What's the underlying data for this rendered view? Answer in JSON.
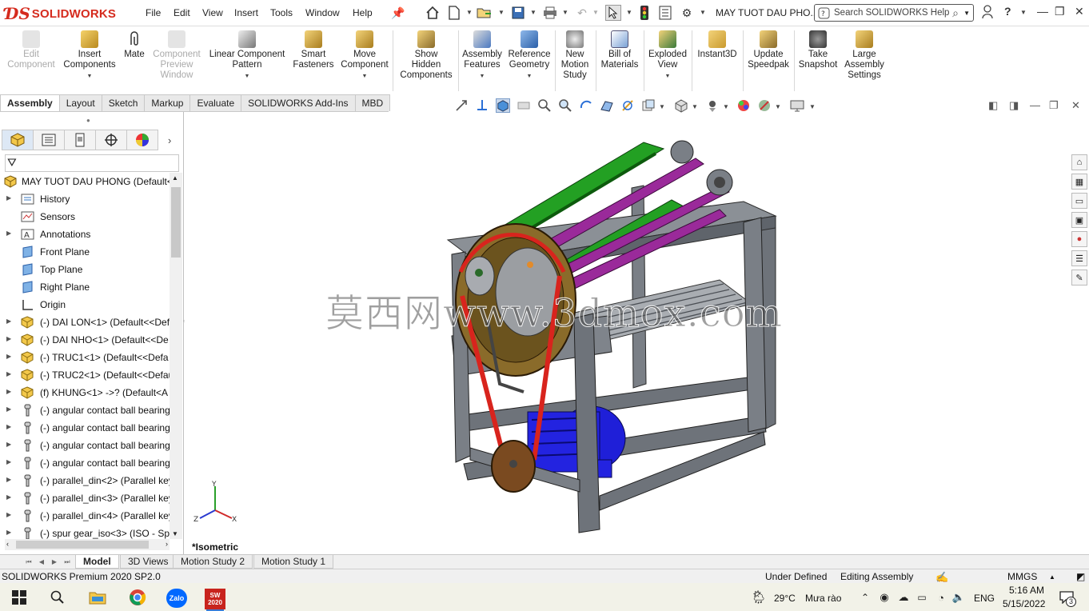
{
  "app": {
    "brand": "SOLIDWORKS",
    "menus": [
      "File",
      "Edit",
      "View",
      "Insert",
      "Tools",
      "Window",
      "Help"
    ],
    "document_title": "MAY TUOT DAU PHO...",
    "search_placeholder": "Search SOLIDWORKS Help"
  },
  "command_manager": {
    "edit_component": "Edit\nComponent",
    "insert_components": "Insert\nComponents",
    "mate": "Mate",
    "component_preview": "Component\nPreview\nWindow",
    "linear_pattern": "Linear Component\nPattern",
    "smart_fasteners": "Smart\nFasteners",
    "move_component": "Move\nComponent",
    "show_hidden": "Show\nHidden\nComponents",
    "assembly_features": "Assembly\nFeatures",
    "reference_geometry": "Reference\nGeometry",
    "new_motion_study": "New\nMotion\nStudy",
    "bill_of_materials": "Bill of\nMaterials",
    "exploded_view": "Exploded\nView",
    "instant3d": "Instant3D",
    "update_speedpak": "Update\nSpeedpak",
    "take_snapshot": "Take\nSnapshot",
    "large_assembly": "Large\nAssembly\nSettings"
  },
  "command_tabs": [
    "Assembly",
    "Layout",
    "Sketch",
    "Markup",
    "Evaluate",
    "SOLIDWORKS Add-Ins",
    "MBD"
  ],
  "tree": {
    "root": "MAY TUOT DAU PHONG  (Default<",
    "items": [
      {
        "label": "History",
        "icon": "history-icon"
      },
      {
        "label": "Sensors",
        "icon": "sensors-icon"
      },
      {
        "label": "Annotations",
        "icon": "annotations-icon"
      },
      {
        "label": "Front Plane",
        "icon": "plane-icon"
      },
      {
        "label": "Top Plane",
        "icon": "plane-icon"
      },
      {
        "label": "Right Plane",
        "icon": "plane-icon"
      },
      {
        "label": "Origin",
        "icon": "origin-icon"
      },
      {
        "label": "(-) DAI LON<1> (Default<<Def",
        "icon": "part-icon"
      },
      {
        "label": "(-) DAI NHO<1> (Default<<De",
        "icon": "part-icon"
      },
      {
        "label": "(-) TRUC1<1> (Default<<Defa",
        "icon": "part-icon"
      },
      {
        "label": "(-) TRUC2<1> (Default<<Defau",
        "icon": "part-icon"
      },
      {
        "label": "(f) KHUNG<1> ->? (Default<A",
        "icon": "part-icon"
      },
      {
        "label": "(-) angular contact ball bearing",
        "icon": "toolbox-icon"
      },
      {
        "label": "(-) angular contact ball bearing",
        "icon": "toolbox-icon"
      },
      {
        "label": "(-) angular contact ball bearing",
        "icon": "toolbox-icon"
      },
      {
        "label": "(-) angular contact ball bearing",
        "icon": "toolbox-icon"
      },
      {
        "label": "(-) parallel_din<2> (Parallel key",
        "icon": "toolbox-icon"
      },
      {
        "label": "(-) parallel_din<3> (Parallel key",
        "icon": "toolbox-icon"
      },
      {
        "label": "(-) parallel_din<4> (Parallel key",
        "icon": "toolbox-icon"
      },
      {
        "label": "(-) spur gear_iso<3> (ISO - Spu",
        "icon": "toolbox-icon"
      }
    ]
  },
  "viewport": {
    "watermark": "莫西网www.3dmox.com",
    "view_name": "*Isometric",
    "axis_labels": {
      "x": "X",
      "y": "Y",
      "z": "Z"
    }
  },
  "bottom_tabs": [
    "Model",
    "3D Views",
    "Motion Study 2",
    "Motion Study 1"
  ],
  "status": {
    "product": "SOLIDWORKS Premium 2020 SP2.0",
    "defined": "Under Defined",
    "mode": "Editing Assembly",
    "units": "MMGS"
  },
  "taskbar": {
    "weather_temp": "29°C",
    "weather_text": "Mưa rào",
    "lang": "ENG",
    "time": "5:16 AM",
    "date": "5/15/2022",
    "notifications": "3",
    "zalo": "Zalo",
    "sw_year": "2020"
  },
  "colors": {
    "brand_red": "#d52b1e",
    "frame_gray": "#6e737a",
    "belt_red": "#d8241d",
    "pulley_brown": "#8a6b2a",
    "motor_blue": "#1c1ce0",
    "roller_green": "#1e8c1e",
    "roller_purple": "#8b1e8b"
  }
}
